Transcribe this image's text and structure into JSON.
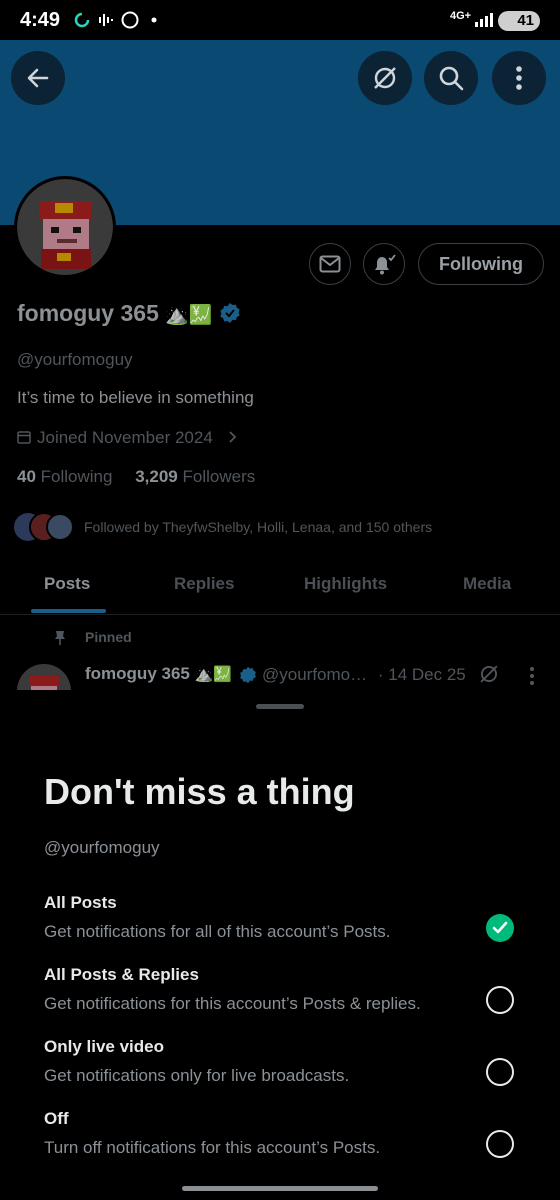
{
  "status_bar": {
    "time": "4:49",
    "network": "4G+",
    "battery": "41"
  },
  "profile": {
    "display_name": "fomoguy 365",
    "name_emoji": "⛰️💹",
    "handle": "@yourfomoguy",
    "bio": "It’s time to believe in something",
    "joined": "Joined November 2024",
    "following_count": "40",
    "following_label": "Following",
    "followers_count": "3,209",
    "followers_label": "Followers",
    "followed_by": "Followed by TheyfwShelby, Holli, Lenaa, and 150 others",
    "following_button": "Following"
  },
  "tabs": [
    {
      "label": "Posts",
      "active": true
    },
    {
      "label": "Replies",
      "active": false
    },
    {
      "label": "Highlights",
      "active": false
    },
    {
      "label": "Media",
      "active": false
    }
  ],
  "pinned_post": {
    "pinned_label": "Pinned",
    "author": "fomoguy 365",
    "author_emoji": "⛰️💹",
    "handle": "@yourfomo…",
    "date": "· 14 Dec 25"
  },
  "sheet": {
    "title": "Don't miss a thing",
    "handle": "@yourfomoguy",
    "options": [
      {
        "title": "All Posts",
        "desc": "Get notifications for all of this account’s Posts.",
        "checked": true
      },
      {
        "title": "All Posts & Replies",
        "desc": "Get notifications for this account’s Posts & replies.",
        "checked": false
      },
      {
        "title": "Only live video",
        "desc": "Get notifications only for live broadcasts.",
        "checked": false
      },
      {
        "title": "Off",
        "desc": "Turn off notifications for this account’s Posts.",
        "checked": false
      }
    ]
  },
  "colors": {
    "banner": "#0a4a72",
    "accent": "#1d9bf0",
    "check": "#00ba7c"
  }
}
